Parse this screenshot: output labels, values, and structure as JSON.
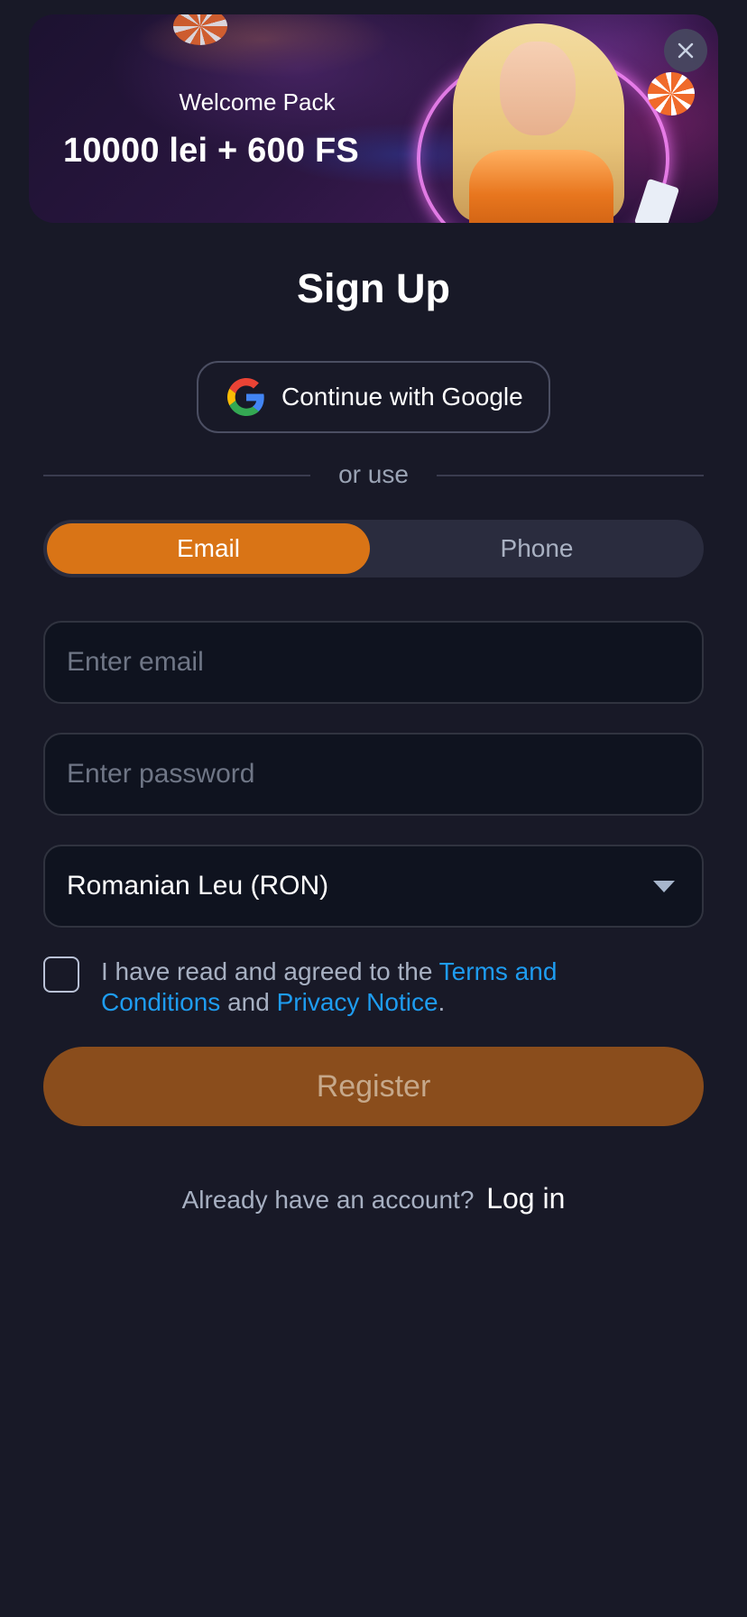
{
  "banner": {
    "welcome": "Welcome Pack",
    "bonus": "10000 lei + 600 FS"
  },
  "title": "Sign Up",
  "google": {
    "label": "Continue with Google"
  },
  "divider": {
    "text": "or use"
  },
  "tabs": {
    "email": "Email",
    "phone": "Phone",
    "active": "email"
  },
  "form": {
    "email_placeholder": "Enter email",
    "password_placeholder": "Enter password",
    "currency": "Romanian Leu (RON)"
  },
  "terms": {
    "prefix": "I have read and agreed to the ",
    "terms_link": "Terms and Conditions",
    "middle": " and ",
    "privacy_link": "Privacy Notice",
    "suffix": ".",
    "checked": false
  },
  "register": {
    "label": "Register"
  },
  "login": {
    "prompt": "Already have an account?",
    "link": "Log in"
  },
  "colors": {
    "background": "#181927",
    "accent": "#d97416",
    "register_disabled": "#8a4d1c",
    "link": "#1e9cf0"
  }
}
